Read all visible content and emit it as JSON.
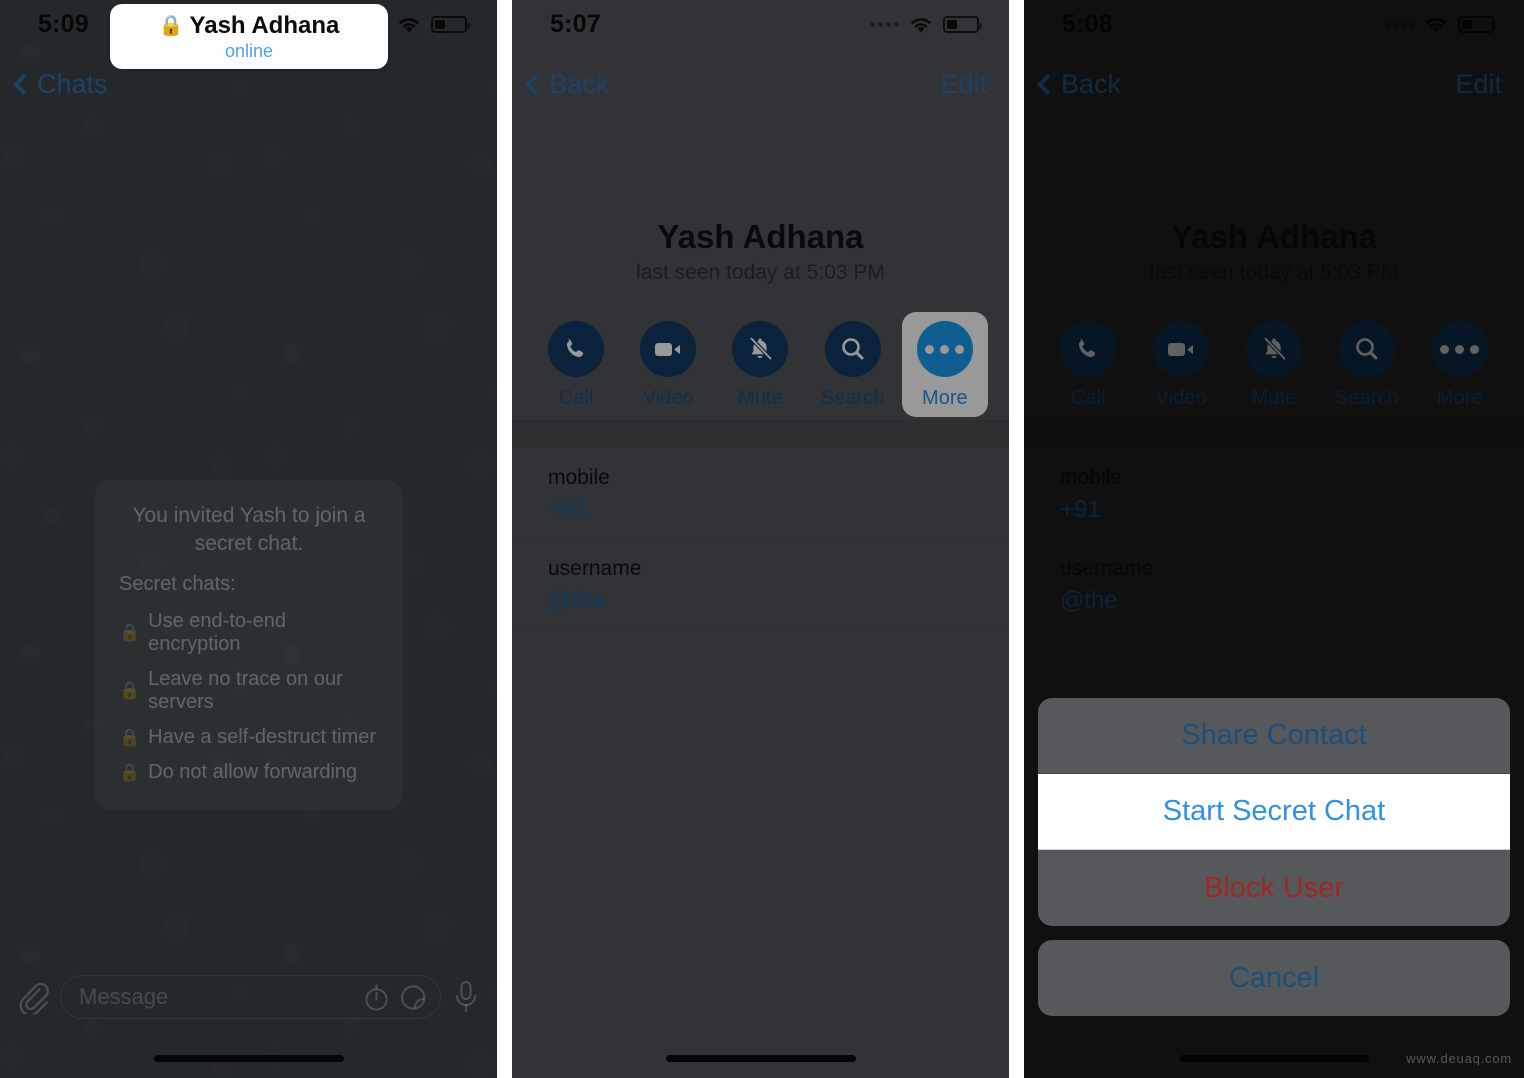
{
  "panels": [
    {
      "id": "chat-panel",
      "status_bar": {
        "time": "5:09",
        "wifi_icon": "wifi-icon",
        "battery_icon": "battery-icon",
        "signal_icon": "signal-dots-icon"
      },
      "navbar": {
        "back_label": "Chats",
        "title": "Yash Adhana",
        "title_lock_icon": "lock-icon",
        "subtitle": "online",
        "avatar_icon": "contact-avatar"
      },
      "secret_notice": {
        "headline": "You invited Yash to join a secret chat.",
        "subhead": "Secret chats:",
        "items": [
          "Use end-to-end encryption",
          "Leave no trace on our servers",
          "Have a self-destruct timer",
          "Do not allow forwarding"
        ],
        "item_icon": "lock-icon"
      },
      "input_bar": {
        "attach_icon": "paperclip-icon",
        "placeholder": "Message",
        "timer_icon": "self-destruct-timer-icon",
        "sticker_icon": "sticker-icon",
        "mic_icon": "microphone-icon"
      }
    },
    {
      "id": "profile-panel",
      "status_bar": {
        "time": "5:07",
        "wifi_icon": "wifi-icon",
        "battery_icon": "battery-icon",
        "signal_icon": "signal-dots-icon"
      },
      "navbar": {
        "back_label": "Back",
        "edit_label": "Edit"
      },
      "hero": {
        "name": "Yash Adhana",
        "last_seen": "last seen today at 5:03 PM",
        "avatar_icon": "contact-avatar"
      },
      "actions": [
        {
          "label": "Call",
          "icon": "phone-icon",
          "highlighted": false
        },
        {
          "label": "Video",
          "icon": "video-camera-icon",
          "highlighted": false
        },
        {
          "label": "Mute",
          "icon": "bell-slash-icon",
          "highlighted": false
        },
        {
          "label": "Search",
          "icon": "search-icon",
          "highlighted": false
        },
        {
          "label": "More",
          "icon": "ellipsis-icon",
          "highlighted": true
        }
      ],
      "info": [
        {
          "label": "mobile",
          "value": "+91"
        },
        {
          "label": "username",
          "value": "@the"
        }
      ]
    },
    {
      "id": "action-sheet-panel",
      "status_bar": {
        "time": "5:08",
        "wifi_icon": "wifi-icon",
        "battery_icon": "battery-icon",
        "signal_icon": "signal-dots-icon"
      },
      "navbar": {
        "back_label": "Back",
        "edit_label": "Edit"
      },
      "hero": {
        "name": "Yash Adhana",
        "last_seen": "last seen today at 5:03 PM",
        "avatar_icon": "contact-avatar"
      },
      "actions": [
        {
          "label": "Call",
          "icon": "phone-icon",
          "highlighted": false
        },
        {
          "label": "Video",
          "icon": "video-camera-icon",
          "highlighted": false
        },
        {
          "label": "Mute",
          "icon": "bell-slash-icon",
          "highlighted": false
        },
        {
          "label": "Search",
          "icon": "search-icon",
          "highlighted": false
        },
        {
          "label": "More",
          "icon": "ellipsis-icon",
          "highlighted": false
        }
      ],
      "info": [
        {
          "label": "mobile",
          "value": "+91"
        },
        {
          "label": "username",
          "value": "@the"
        }
      ],
      "action_sheet": {
        "options": [
          {
            "label": "Share Contact",
            "style": "default",
            "selected": false
          },
          {
            "label": "Start Secret Chat",
            "style": "default",
            "selected": true
          },
          {
            "label": "Block User",
            "style": "destructive",
            "selected": false
          }
        ],
        "cancel_label": "Cancel"
      }
    }
  ],
  "watermark": "www.deuaq.com",
  "colors": {
    "accent_blue": "#2f90e8",
    "link_blue": "#2f6fb0",
    "destructive_red": "#9d2a22",
    "chat_background": "#3e4348",
    "profile_background": "#54565a"
  }
}
